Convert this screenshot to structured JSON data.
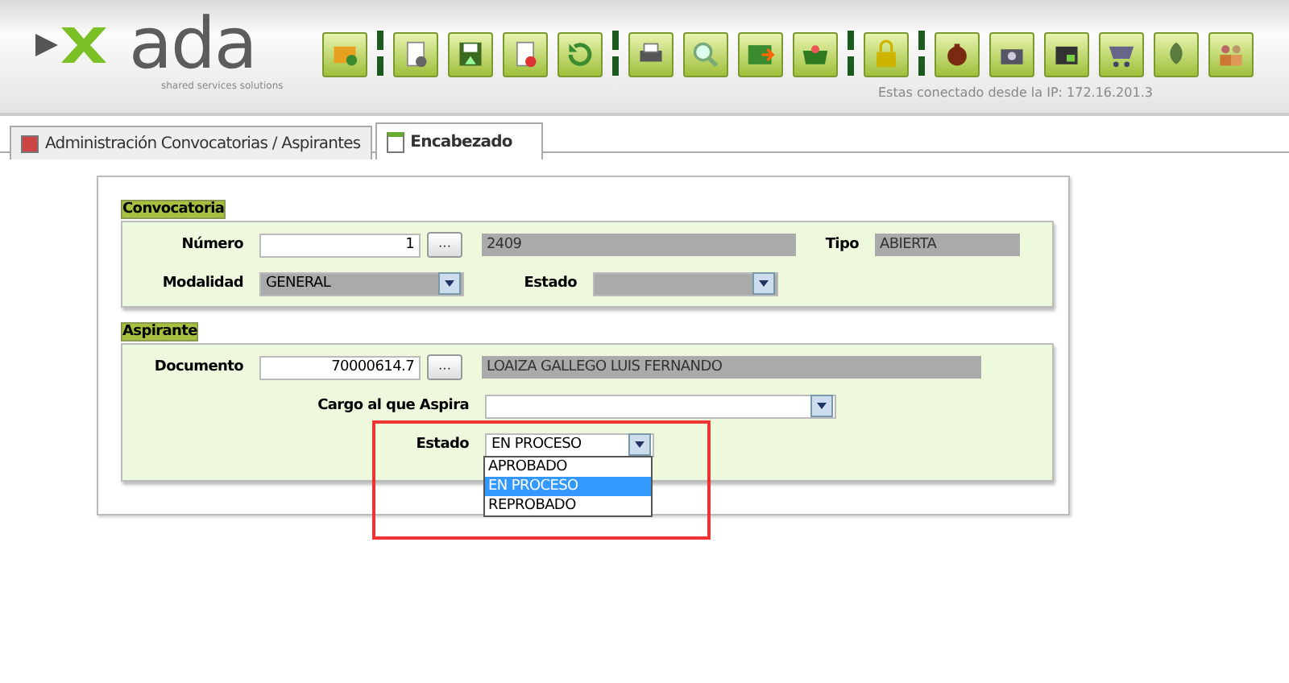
{
  "header": {
    "logo": "ada",
    "tagline": "shared services solutions",
    "connection": "Estas conectado desde la IP: 172.16.201.3"
  },
  "tabs": [
    {
      "label": "Administración Convocatorias / Aspirantes",
      "selected": false
    },
    {
      "label": "Encabezado",
      "selected": true
    }
  ],
  "convocatoria": {
    "title": "Convocatoria",
    "numero_label": "Número",
    "numero": "1",
    "lookup": "···",
    "code": "2409",
    "tipo_label": "Tipo",
    "tipo": "ABIERTA",
    "modalidad_label": "Modalidad",
    "modalidad": "GENERAL",
    "estado_label": "Estado"
  },
  "aspirante": {
    "title": "Aspirante",
    "documento_label": "Documento",
    "documento": "70000614.7",
    "lookup": "···",
    "nombre": "LOAIZA GALLEGO LUIS FERNANDO",
    "cargo_label": "Cargo al que Aspira",
    "estado_label": "Estado",
    "estado": "EN PROCESO",
    "options": [
      {
        "label": "APROBADO",
        "selected": false
      },
      {
        "label": "EN PROCESO",
        "selected": true
      },
      {
        "label": "REPROBADO",
        "selected": false
      }
    ]
  }
}
